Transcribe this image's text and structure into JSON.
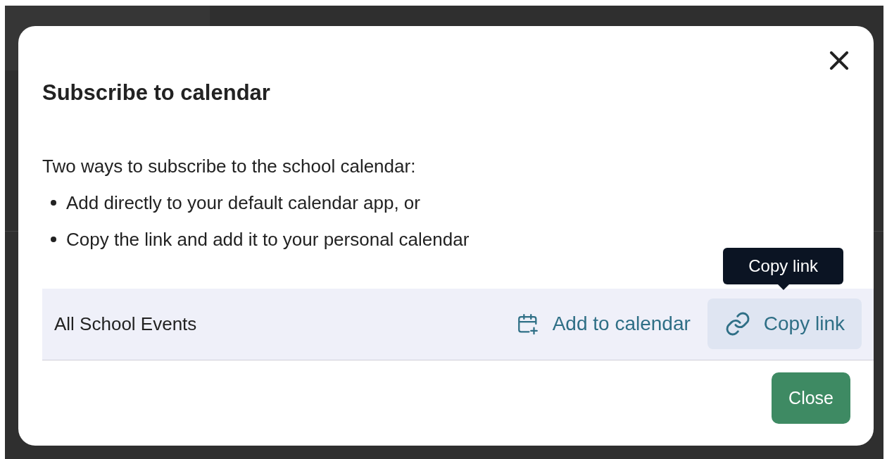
{
  "dialog": {
    "title": "Subscribe to calendar",
    "intro": "Two ways to subscribe to the school calendar:",
    "bullets": [
      "Add directly to your default calendar app, or",
      "Copy the link and add it to your personal calendar"
    ],
    "calendar_row": {
      "name": "All School Events",
      "actions": [
        {
          "kind": "add",
          "label": "Add to calendar",
          "hovered": false
        },
        {
          "kind": "copy",
          "label": "Copy link",
          "hovered": true
        }
      ],
      "tooltip": "Copy link"
    },
    "close_button": "Close"
  }
}
